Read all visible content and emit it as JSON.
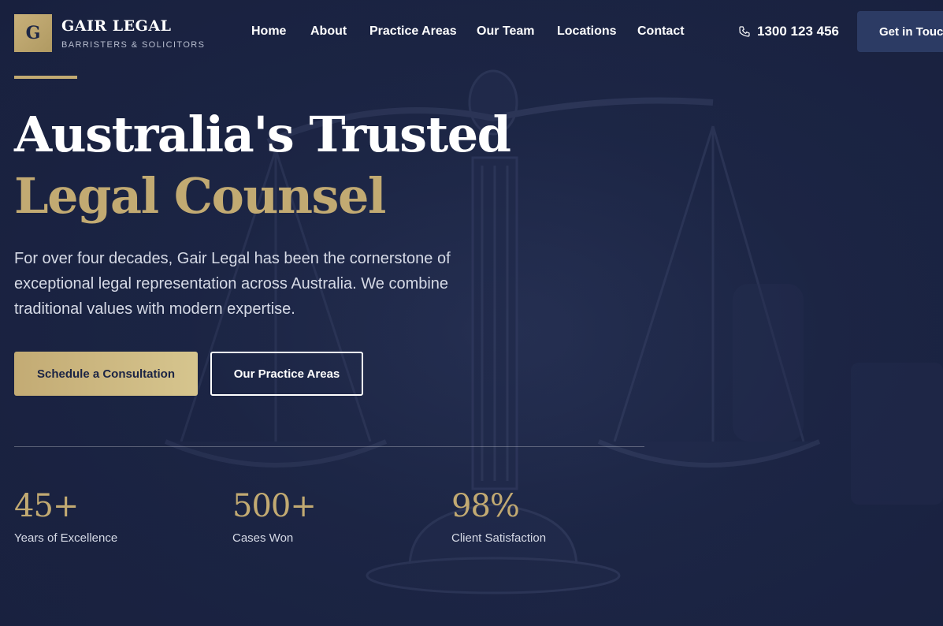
{
  "brand": {
    "logo_letter": "G",
    "name": "GAIR LEGAL",
    "subtitle": "BARRISTERS & SOLICITORS"
  },
  "nav": {
    "items": [
      {
        "label": "Home"
      },
      {
        "label": "About"
      },
      {
        "label": "Practice Areas"
      },
      {
        "label": "Our Team"
      },
      {
        "label": "Locations"
      },
      {
        "label": "Contact"
      }
    ],
    "phone": "1300 123 456",
    "phone_icon": "phone-icon",
    "cta": "Get in Touch"
  },
  "hero": {
    "headline_white": "Australia's Trusted ",
    "headline_gold": "Legal Counsel",
    "lead": "For over four decades, Gair Legal has been the cornerstone of exceptional legal representation across Australia. We combine traditional values with modern expertise.",
    "primary_button": "Schedule a Consultation",
    "secondary_button": "Our Practice Areas",
    "background_image": "scales-of-justice"
  },
  "stats": [
    {
      "value": "45+",
      "label": "Years of Excellence"
    },
    {
      "value": "500+",
      "label": "Cases Won"
    },
    {
      "value": "98%",
      "label": "Client Satisfaction"
    }
  ],
  "colors": {
    "background": "#1b2444",
    "gold": "#c2aa72",
    "button_dark": "#2c3b64"
  }
}
